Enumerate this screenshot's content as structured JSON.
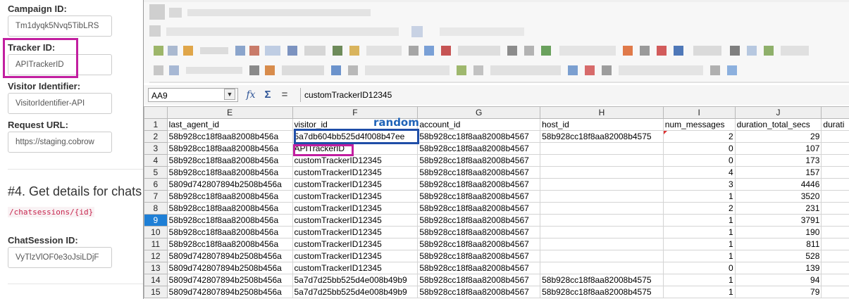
{
  "form": {
    "campaign_label": "Campaign ID:",
    "campaign_value": "Tm1dyqk5Nvq5TibLRS",
    "tracker_label": "Tracker ID:",
    "tracker_value": "APITrackerID",
    "visitor_label": "Visitor Identifier:",
    "visitor_value": "VisitorIdentifier-API",
    "request_label": "Request URL:",
    "request_value": "https://staging.cobrow",
    "section_title": "#4. Get details for chats",
    "endpoint": "/chatsessions/{id}",
    "chatsession_label": "ChatSession ID:",
    "chatsession_value": "VyTlzVlOF0e3oJsiLDjF"
  },
  "spreadsheet": {
    "name_box": "AA9",
    "formula_value": "customTrackerID12345",
    "icons": {
      "fx": "function-wizard-icon",
      "sum": "sum-icon",
      "equals": "equals-icon"
    },
    "annotation": "random",
    "columns": [
      "E",
      "F",
      "G",
      "H",
      "I",
      "J",
      ""
    ],
    "selected_row": 9,
    "rows": [
      {
        "n": "1",
        "e": "last_agent_id",
        "f": "visitor_id",
        "g": "account_id",
        "h": "host_id",
        "i": "num_messages",
        "j": "duration_total_secs",
        "k": "durati"
      },
      {
        "n": "2",
        "e": "58b928cc18f8aa82008b456a",
        "f": "5a7db604bb525d4f008b47ee",
        "g": "58b928cc18f8aa82008b4567",
        "h": "58b928cc18f8aa82008b4575",
        "i": "2",
        "j": "29",
        "k": ""
      },
      {
        "n": "3",
        "e": "58b928cc18f8aa82008b456a",
        "f": "APITrackerID",
        "g": "58b928cc18f8aa82008b4567",
        "h": "",
        "i": "0",
        "j": "107",
        "k": ""
      },
      {
        "n": "4",
        "e": "58b928cc18f8aa82008b456a",
        "f": "customTrackerID12345",
        "g": "58b928cc18f8aa82008b4567",
        "h": "",
        "i": "0",
        "j": "173",
        "k": ""
      },
      {
        "n": "5",
        "e": "58b928cc18f8aa82008b456a",
        "f": "customTrackerID12345",
        "g": "58b928cc18f8aa82008b4567",
        "h": "",
        "i": "4",
        "j": "157",
        "k": ""
      },
      {
        "n": "6",
        "e": "5809d742807894b2508b456a",
        "f": "customTrackerID12345",
        "g": "58b928cc18f8aa82008b4567",
        "h": "",
        "i": "3",
        "j": "4446",
        "k": ""
      },
      {
        "n": "7",
        "e": "58b928cc18f8aa82008b456a",
        "f": "customTrackerID12345",
        "g": "58b928cc18f8aa82008b4567",
        "h": "",
        "i": "1",
        "j": "3520",
        "k": ""
      },
      {
        "n": "8",
        "e": "58b928cc18f8aa82008b456a",
        "f": "customTrackerID12345",
        "g": "58b928cc18f8aa82008b4567",
        "h": "",
        "i": "2",
        "j": "231",
        "k": ""
      },
      {
        "n": "9",
        "e": "58b928cc18f8aa82008b456a",
        "f": "customTrackerID12345",
        "g": "58b928cc18f8aa82008b4567",
        "h": "",
        "i": "1",
        "j": "3791",
        "k": ""
      },
      {
        "n": "10",
        "e": "58b928cc18f8aa82008b456a",
        "f": "customTrackerID12345",
        "g": "58b928cc18f8aa82008b4567",
        "h": "",
        "i": "1",
        "j": "190",
        "k": ""
      },
      {
        "n": "11",
        "e": "58b928cc18f8aa82008b456a",
        "f": "customTrackerID12345",
        "g": "58b928cc18f8aa82008b4567",
        "h": "",
        "i": "1",
        "j": "811",
        "k": ""
      },
      {
        "n": "12",
        "e": "5809d742807894b2508b456a",
        "f": "customTrackerID12345",
        "g": "58b928cc18f8aa82008b4567",
        "h": "",
        "i": "1",
        "j": "528",
        "k": ""
      },
      {
        "n": "13",
        "e": "5809d742807894b2508b456a",
        "f": "customTrackerID12345",
        "g": "58b928cc18f8aa82008b4567",
        "h": "",
        "i": "0",
        "j": "139",
        "k": ""
      },
      {
        "n": "14",
        "e": "5809d742807894b2508b456a",
        "f": "5a7d7d25bb525d4e008b49b9",
        "g": "58b928cc18f8aa82008b4567",
        "h": "58b928cc18f8aa82008b4575",
        "i": "1",
        "j": "94",
        "k": ""
      },
      {
        "n": "15",
        "e": "5809d742807894b2508b456a",
        "f": "5a7d7d25bb525d4e008b49b9",
        "g": "58b928cc18f8aa82008b4567",
        "h": "58b928cc18f8aa82008b4575",
        "i": "1",
        "j": "79",
        "k": ""
      }
    ]
  },
  "colors": {
    "highlight_pink": "#c21fa0",
    "highlight_blue": "#1f4ea8",
    "selected_row": "#1e7fd6"
  }
}
